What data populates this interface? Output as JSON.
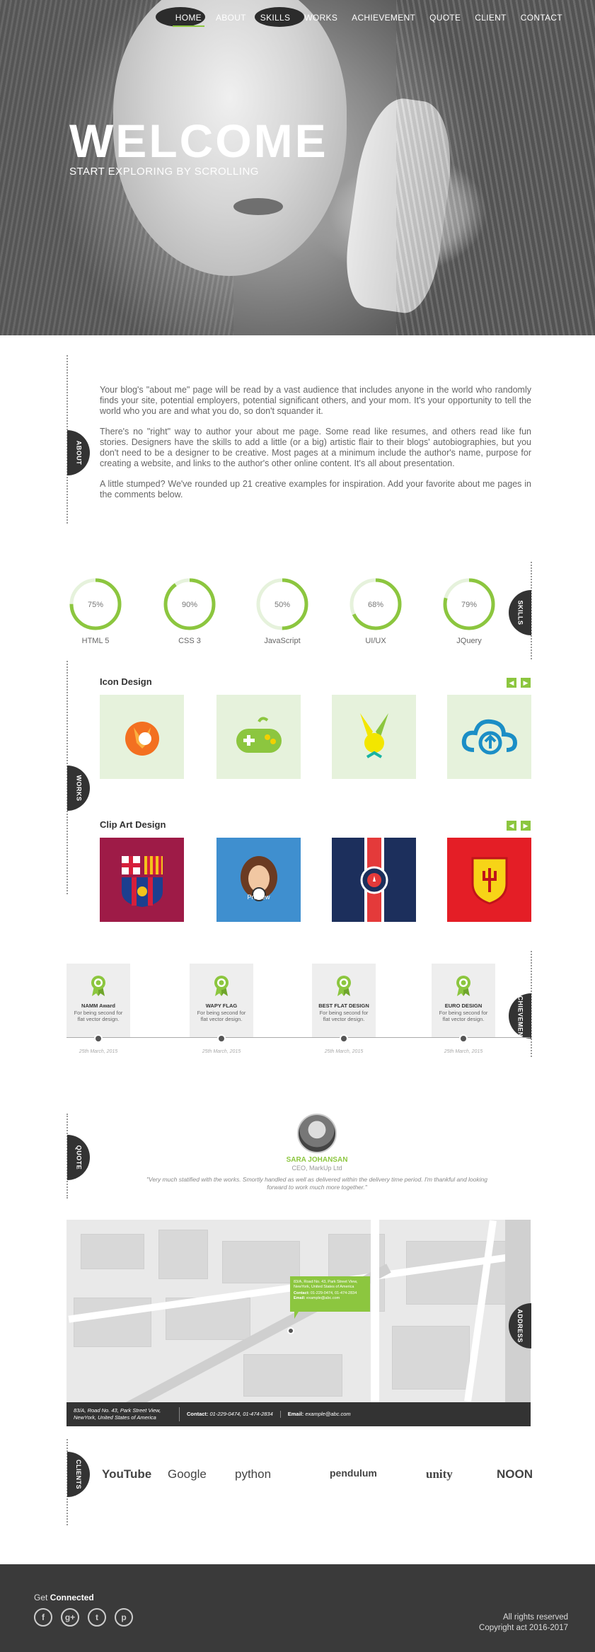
{
  "nav": [
    "HOME",
    "ABOUT",
    "SKILLS",
    "WORKS",
    "ACHIEVEMENT",
    "QUOTE",
    "CLIENT",
    "CONTACT"
  ],
  "hero": {
    "title": "WELCOME",
    "subtitle": "START EXPLORING BY SCROLLING"
  },
  "about": {
    "tab": "ABOUT",
    "paragraphs": [
      "Your blog's \"about me\" page will be read by a vast audience that includes anyone in the world who randomly finds your site, potential employers, potential significant others, and your mom. It's your opportunity to tell the world who you are and what you do, so don't squander it.",
      "There's no \"right\" way to author your about me page. Some read like resumes, and others read like fun stories. Designers have the skills to add a little (or a big) artistic flair to their blogs' autobiographies, but you don't need to be a designer to be creative. Most pages at a minimum include the author's name, purpose for creating a website, and links to the author's other online content. It's all about presentation.",
      "A little stumped? We've rounded up 21 creative examples for inspiration. Add your favorite about me pages in the comments below."
    ]
  },
  "skills": {
    "tab": "SKILLS",
    "items": [
      {
        "label": "HTML 5",
        "value": 75,
        "text": "75%"
      },
      {
        "label": "CSS 3",
        "value": 90,
        "text": "90%"
      },
      {
        "label": "JavaScript",
        "value": 50,
        "text": "50%"
      },
      {
        "label": "UI/UX",
        "value": 68,
        "text": "68%"
      },
      {
        "label": "JQuery",
        "value": 79,
        "text": "79%"
      }
    ]
  },
  "works": {
    "tab": "WORKS",
    "icon_title": "Icon Design",
    "clip_title": "Clip Art Design",
    "preview": "Preview",
    "prev_icon": "prev-arrow-icon",
    "next_icon": "next-arrow-icon"
  },
  "achievement": {
    "tab": "ACHIEVEMENT",
    "items": [
      {
        "title": "NAMM Award",
        "desc": "For being second for flat vector design.",
        "date": "25th March, 2015"
      },
      {
        "title": "WAPY FLAG",
        "desc": "For being second for flat vector design.",
        "date": "25th March, 2015"
      },
      {
        "title": "BEST FLAT DESIGN",
        "desc": "For being second for flat vector design.",
        "date": "25th March, 2015"
      },
      {
        "title": "EURO DESIGN",
        "desc": "For being second for flat vector design.",
        "date": "25th March, 2015"
      }
    ]
  },
  "quote": {
    "tab": "QUOTE",
    "name": "SARA JOHANSAN",
    "position": "CEO, MarkUp Ltd",
    "text": "\"Very much statified with the works. Smortly handled as well as delivered within the delivery time period. I'm thankful and looking forward to work much more together.\""
  },
  "address": {
    "tab": "ADDRESS",
    "bubble_addr": "83/A, Road No. 43, Park Street View, NewYork, United States of America",
    "bubble_contact_label": "Contact:",
    "bubble_contact": "01-229-0474, 01-474-2834",
    "bubble_email_label": "Email:",
    "bubble_email": "example@abc.com",
    "bar_addr": "83/A, Road No. 43, Park Street View, NewYork, United States of America",
    "bar_contact_label": "Contact:",
    "bar_contact": "01-229-0474, 01-474-2834",
    "bar_email_label": "Email:",
    "bar_email": "example@abc.com"
  },
  "clients": {
    "tab": "CLIENTS",
    "logos": [
      "YouTube",
      "Google",
      "python",
      "pendulum",
      "unity",
      "NOON"
    ]
  },
  "footer": {
    "get": "Get",
    "connected": "Connected",
    "socials": [
      "f",
      "g+",
      "t",
      "p"
    ],
    "rights": "All rights reserved",
    "copyright": "Copyright act 2016-2017"
  },
  "colors": {
    "accent": "#8cc63f",
    "dark": "#333333"
  }
}
